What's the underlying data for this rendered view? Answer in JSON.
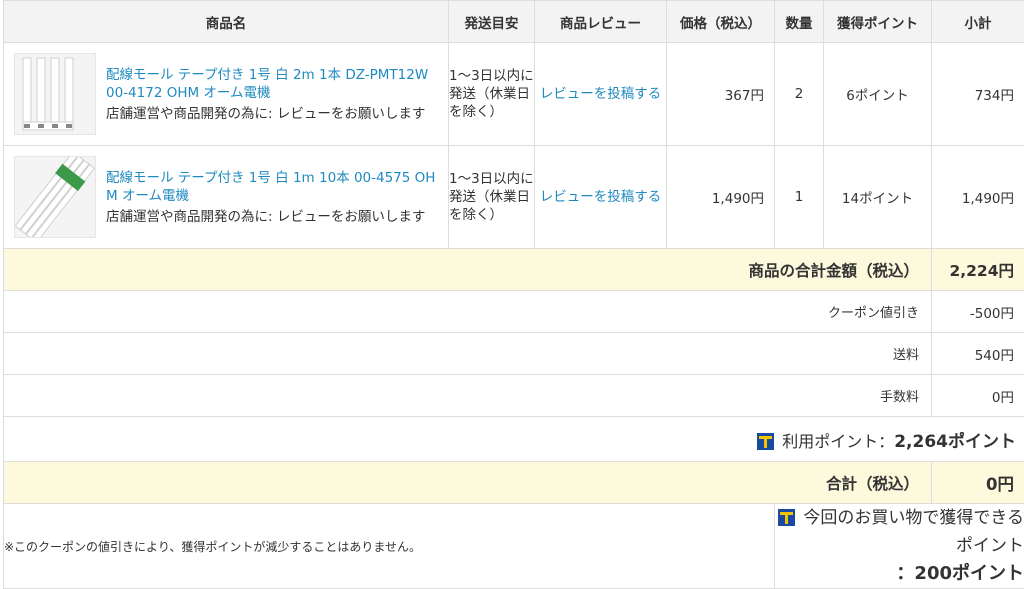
{
  "headers": {
    "product": "商品名",
    "shipping": "発送目安",
    "review": "商品レビュー",
    "price": "価格（税込）",
    "qty": "数量",
    "points": "獲得ポイント",
    "subtotal": "小計"
  },
  "items": [
    {
      "name": "配線モール テープ付き 1号 白 2m 1本 DZ-PMT12W 00-4172 OHM オーム電機",
      "note": "店舗運営や商品開発の為に: レビューをお願いします",
      "shipping": "1〜3日以内に発送（休業日を除く）",
      "review_link": "レビューを投稿する",
      "price": "367円",
      "qty": "2",
      "points": "6ポイント",
      "subtotal": "734円"
    },
    {
      "name": "配線モール テープ付き 1号 白 1m 10本 00-4575 OHM オーム電機",
      "note": "店舗運営や商品開発の為に: レビューをお願いします",
      "shipping": "1〜3日以内に発送（休業日を除く）",
      "review_link": "レビューを投稿する",
      "price": "1,490円",
      "qty": "1",
      "points": "14ポイント",
      "subtotal": "1,490円"
    }
  ],
  "summary": {
    "goods_total_label": "商品の合計金額（税込）",
    "goods_total": "2,224円",
    "coupon_label": "クーポン値引き",
    "coupon": "-500円",
    "shipping_label": "送料",
    "shipping": "540円",
    "fee_label": "手数料",
    "fee": "0円",
    "used_points_label": "利用ポイント：",
    "used_points": "2,264ポイント",
    "grand_total_label": "合計（税込）",
    "grand_total": "0円"
  },
  "footer": {
    "note": "※このクーポンの値引きにより、獲得ポイントが減少することはありません。",
    "earn_label": "今回のお買い物で獲得できるポイント",
    "earn_value": "：200ポイント"
  },
  "colors": {
    "link": "#1f8ac0",
    "header_bg": "#f3f3f3",
    "highlight_bg": "#fdf9dc",
    "tpoint_blue": "#1a4aa0",
    "tpoint_yellow": "#f5c400"
  },
  "icons": {
    "tpoint": "t-point-icon"
  }
}
